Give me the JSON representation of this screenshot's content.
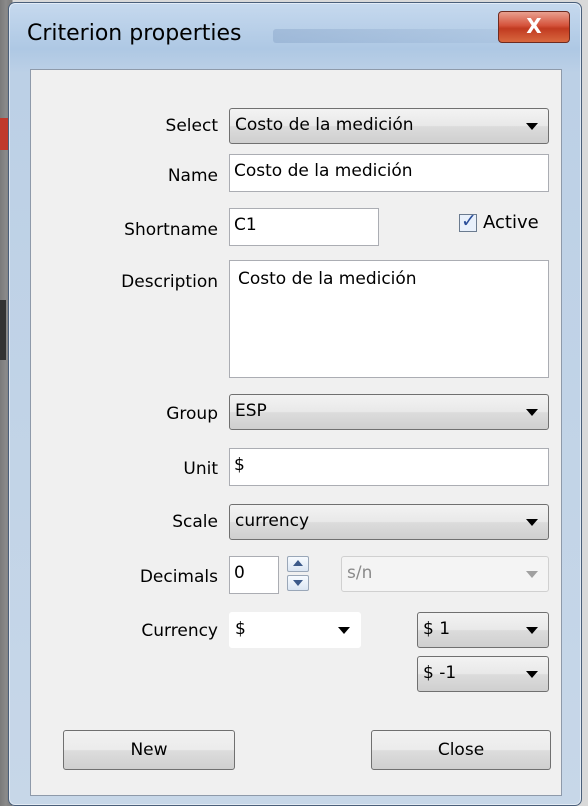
{
  "window": {
    "title": "Criterion properties",
    "close_glyph": "X"
  },
  "form": {
    "select": {
      "label": "Select",
      "value": "Costo de la medición"
    },
    "name": {
      "label": "Name",
      "value": "Costo de la medición"
    },
    "shortname": {
      "label": "Shortname",
      "value": "C1"
    },
    "active": {
      "label": "Active",
      "checked": true
    },
    "description": {
      "label": "Description",
      "value": "Costo de la medición"
    },
    "group": {
      "label": "Group",
      "value": "ESP"
    },
    "unit": {
      "label": "Unit",
      "value": "$"
    },
    "scale": {
      "label": "Scale",
      "value": "currency"
    },
    "decimals": {
      "label": "Decimals",
      "value": "0",
      "format_value": "s/n"
    },
    "currency": {
      "label": "Currency",
      "value": "$",
      "positive_format": "$ 1",
      "negative_format": "$ -1"
    }
  },
  "buttons": {
    "new_label": "New",
    "close_label": "Close"
  },
  "icons": {
    "close": "close-icon",
    "check": "check-icon",
    "dropdown": "chevron-down-icon",
    "spin_up": "spin-up-icon",
    "spin_down": "spin-down-icon"
  }
}
